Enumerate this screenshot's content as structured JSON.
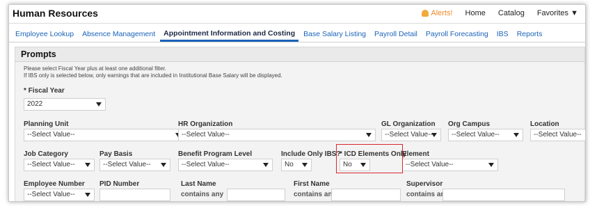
{
  "app": {
    "title": "Human Resources"
  },
  "topnav": {
    "alerts": "Alerts!",
    "home": "Home",
    "catalog": "Catalog",
    "favorites": "Favorites ▼"
  },
  "tabs": [
    "Employee Lookup",
    "Absence Management",
    "Appointment Information and Costing",
    "Base Salary Listing",
    "Payroll Detail",
    "Payroll Forecasting",
    "IBS",
    "Reports"
  ],
  "prompts": {
    "title": "Prompts",
    "info_line1": "Please select Fiscal Year plus at least one additional filter.",
    "info_line2": "If IBS only is selected below, only earnings that are included in Institutional Base Salary will be displayed.",
    "fiscal_year": {
      "label": "* Fiscal Year",
      "value": "2022"
    },
    "planning_unit": {
      "label": "Planning Unit",
      "value": "--Select Value--"
    },
    "hr_org": {
      "label": "HR Organization",
      "value": "--Select Value--"
    },
    "gl_org": {
      "label": "GL Organization",
      "value": "--Select Value--"
    },
    "org_campus": {
      "label": "Org Campus",
      "value": "--Select Value--"
    },
    "location": {
      "label": "Location",
      "value": "--Select Value--"
    },
    "job_category": {
      "label": "Job Category",
      "value": "--Select Value--"
    },
    "pay_basis": {
      "label": "Pay Basis",
      "value": "--Select Value--"
    },
    "benefit_program": {
      "label": "Benefit Program Level",
      "value": "--Select Value--"
    },
    "include_ibs": {
      "label": "Include Only IBS?",
      "value": "No"
    },
    "icd_elements": {
      "label": "* ICD Elements Only",
      "value": "No"
    },
    "element": {
      "label": "Element",
      "value": "--Select Value--"
    },
    "employee_number": {
      "label": "Employee Number",
      "value": "--Select Value--"
    },
    "pid_number": {
      "label": "PID Number"
    },
    "last_name": {
      "label": "Last Name",
      "operator": "contains any"
    },
    "first_name": {
      "label": "First Name",
      "operator": "contains any"
    },
    "supervisor": {
      "label": "Supervisor",
      "operator": "contains any"
    }
  }
}
